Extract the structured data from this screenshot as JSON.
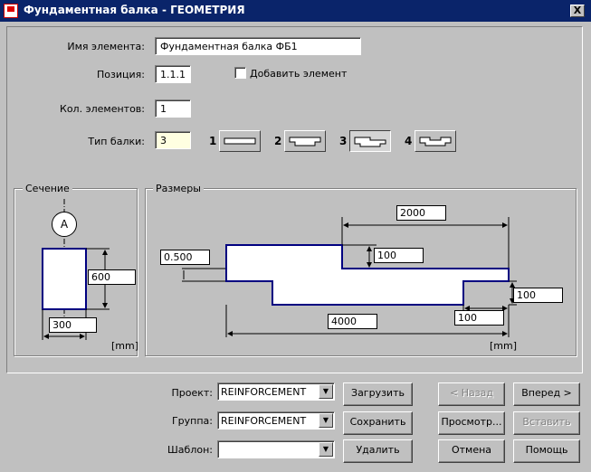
{
  "window": {
    "title": "Фундаментная балка - ГЕОМЕТРИЯ",
    "close_label": "X"
  },
  "form": {
    "name_label": "Имя элемента:",
    "name_value": "Фундаментная балка ФБ1",
    "position_label": "Позиция:",
    "position_value": "1.1.1",
    "add_element_label": "Добавить элемент",
    "count_label": "Кол. элементов:",
    "count_value": "1",
    "beam_type_label": "Тип балки:",
    "beam_type_value": "3",
    "beam_types": [
      {
        "num": "1",
        "selected": false
      },
      {
        "num": "2",
        "selected": false
      },
      {
        "num": "3",
        "selected": true
      },
      {
        "num": "4",
        "selected": false
      }
    ]
  },
  "section": {
    "label": "Сечение",
    "marker": "A",
    "height": "600",
    "width": "300",
    "units": "[mm]"
  },
  "dimensions": {
    "label": "Размеры",
    "top_length": "2000",
    "step_height": "100",
    "slope": "0.500",
    "bottom_right": "100",
    "bottom_step": "100",
    "total_length": "4000",
    "units": "[mm]"
  },
  "footer": {
    "project_label": "Проект:",
    "project_value": "REINFORCEMENT",
    "group_label": "Группа:",
    "group_value": "REINFORCEMENT",
    "template_label": "Шаблон:",
    "template_value": "",
    "load_button": "Загрузить",
    "save_button": "Сохранить",
    "delete_button": "Удалить",
    "back_button": "< Назад",
    "next_button": "Вперед  >",
    "preview_button": "Просмотр...",
    "insert_button": "Вставить",
    "cancel_button": "Отмена",
    "help_button": "Помощь"
  }
}
